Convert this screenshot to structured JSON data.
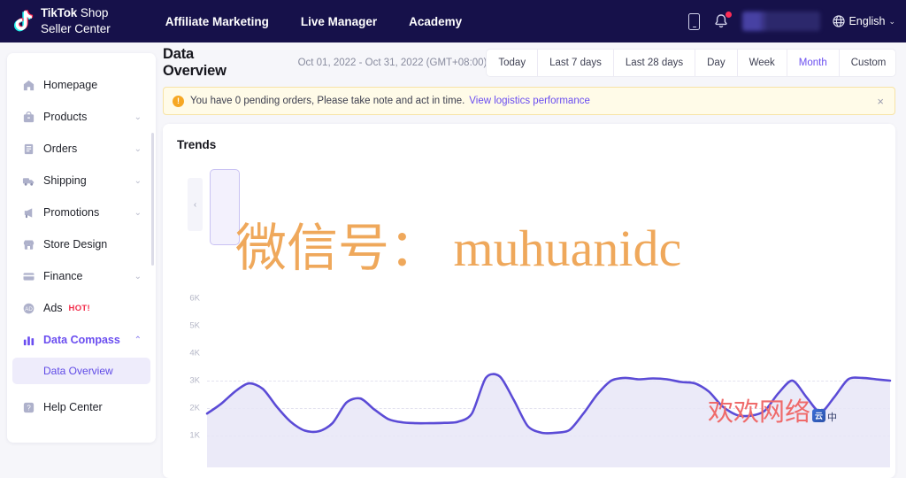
{
  "topnav": {
    "brand": {
      "line1_bold": "TikTok",
      "line1_rest": " Shop",
      "line2": "Seller Center",
      "logo_icon": "tiktok-note-icon"
    },
    "links": [
      {
        "label": "Affiliate Marketing"
      },
      {
        "label": "Live Manager"
      },
      {
        "label": "Academy"
      }
    ],
    "icons": {
      "phone": "phone-icon",
      "bell": "bell-icon",
      "globe": "globe-icon"
    },
    "language": {
      "label": "English",
      "chevron": "⌄"
    },
    "notification_dot": true
  },
  "sidebar": {
    "items": [
      {
        "label": "Homepage",
        "icon": "home-icon",
        "expandable": false,
        "active": false
      },
      {
        "label": "Products",
        "icon": "bag-icon",
        "expandable": true,
        "active": false
      },
      {
        "label": "Orders",
        "icon": "document-icon",
        "expandable": true,
        "active": false
      },
      {
        "label": "Shipping",
        "icon": "truck-icon",
        "expandable": true,
        "active": false
      },
      {
        "label": "Promotions",
        "icon": "megaphone-icon",
        "expandable": true,
        "active": false
      },
      {
        "label": "Store Design",
        "icon": "storefront-icon",
        "expandable": false,
        "active": false
      },
      {
        "label": "Finance",
        "icon": "card-icon",
        "expandable": true,
        "active": false
      },
      {
        "label": "Ads",
        "icon": "ads-icon",
        "expandable": false,
        "active": false,
        "badge": "HOT!"
      },
      {
        "label": "Data Compass",
        "icon": "bar-chart-icon",
        "expandable": true,
        "active": true,
        "expanded": true
      },
      {
        "label": "Help Center",
        "icon": "help-icon",
        "expandable": false,
        "active": false
      }
    ],
    "subitem": {
      "label": "Data Overview",
      "selected": true
    },
    "chevron_down": "⌄",
    "chevron_up": "⌃"
  },
  "main": {
    "page_title": "Data Overview",
    "date_range": "Oct 01, 2022 - Oct 31, 2022 (GMT+08:00)",
    "segments": [
      {
        "label": "Today",
        "active": false
      },
      {
        "label": "Last 7 days",
        "active": false
      },
      {
        "label": "Last 28 days",
        "active": false
      },
      {
        "label": "Day",
        "active": false
      },
      {
        "label": "Week",
        "active": false
      },
      {
        "label": "Month",
        "active": true
      },
      {
        "label": "Custom",
        "active": false
      }
    ],
    "alert": {
      "icon": "warning-icon",
      "icon_glyph": "!",
      "text": "You have 0 pending orders, Please take note and act in time.",
      "link": "View logistics performance",
      "close": "×"
    },
    "card": {
      "title": "Trends",
      "carousel_prev": "‹"
    }
  },
  "colors": {
    "nav_background": "#16114a",
    "accent_purple": "#6a4df0",
    "alert_background": "#fffbe8",
    "alert_border": "#f7e3a6",
    "warning_orange": "#f6a723",
    "hot_red": "#f22c4a",
    "chart_line": "#5b4bd6",
    "chart_fill": "#e7e5f8",
    "notification_red": "#fe2c55"
  },
  "watermarks": {
    "center": "微信号： muhuanidc",
    "bottom_right_text": "欢欢网络",
    "bottom_right_badge": "云",
    "bottom_right_suffix": "中"
  },
  "chart_data": {
    "type": "area",
    "title": "Trends",
    "xlabel": "",
    "ylabel": "",
    "ylim": [
      0,
      6500
    ],
    "grid": true,
    "legend": "none",
    "tick_labels": [
      "6K",
      "5K",
      "4K",
      "3K",
      "2K",
      "1K"
    ],
    "tick_values": [
      6000,
      5000,
      4000,
      3000,
      2000,
      1000
    ],
    "series": [
      {
        "name": "Trend",
        "color": "#5b4bd6",
        "values": [
          1800,
          2150,
          2600,
          2900,
          2700,
          2050,
          1500,
          1180,
          1150,
          1450,
          2200,
          2350,
          1950,
          1600,
          1480,
          1450,
          1450,
          1460,
          1500,
          1800,
          3100,
          3150,
          2300,
          1350,
          1100,
          1100,
          1200,
          1800,
          2500,
          3000,
          3100,
          3050,
          3080,
          3050,
          2950,
          2900,
          2600,
          2050,
          1750,
          1720,
          1900,
          2550,
          3000,
          2400,
          1850,
          2400,
          3050,
          3100,
          3050,
          3000
        ]
      }
    ]
  }
}
